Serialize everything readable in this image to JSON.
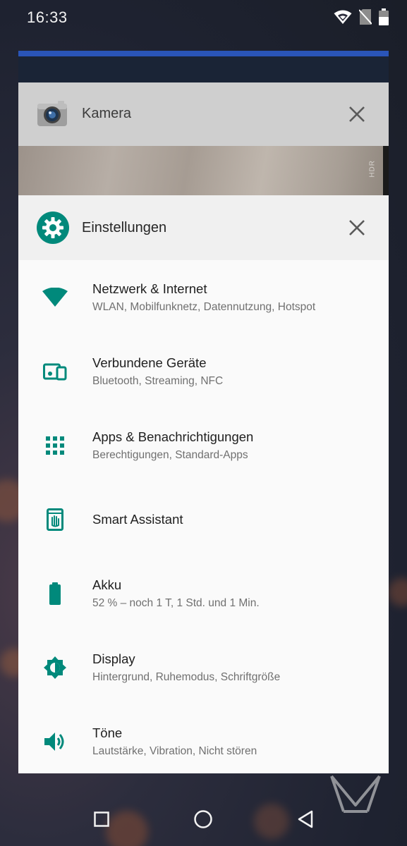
{
  "status_bar": {
    "time": "16:33",
    "icons": [
      "wifi-icon",
      "no-sim-icon",
      "battery-icon"
    ]
  },
  "recents": {
    "camera_card": {
      "title": "Kamera",
      "icon": "camera-app-icon",
      "preview_label": "HDR",
      "close_icon": "close-icon"
    },
    "settings_card": {
      "title": "Einstellungen",
      "icon": "settings-gear-icon",
      "close_icon": "close-icon",
      "accent_color": "#00897b",
      "items": [
        {
          "title": "Netzwerk & Internet",
          "subtitle": "WLAN, Mobilfunknetz, Datennutzung, Hotspot",
          "icon": "wifi-icon"
        },
        {
          "title": "Verbundene Geräte",
          "subtitle": "Bluetooth, Streaming, NFC",
          "icon": "connected-devices-icon"
        },
        {
          "title": "Apps & Benachrichtigungen",
          "subtitle": "Berechtigungen, Standard-Apps",
          "icon": "apps-grid-icon"
        },
        {
          "title": "Smart Assistant",
          "subtitle": "",
          "icon": "smart-assistant-icon"
        },
        {
          "title": "Akku",
          "subtitle": "52 % – noch 1 T, 1 Std. und 1 Min.",
          "icon": "battery-icon"
        },
        {
          "title": "Display",
          "subtitle": "Hintergrund, Ruhemodus, Schriftgröße",
          "icon": "brightness-icon"
        },
        {
          "title": "Töne",
          "subtitle": "Lautstärke, Vibration, Nicht stören",
          "icon": "volume-icon"
        }
      ]
    }
  },
  "nav_bar": {
    "buttons": [
      "recents-square-icon",
      "home-circle-icon",
      "back-triangle-icon"
    ]
  }
}
